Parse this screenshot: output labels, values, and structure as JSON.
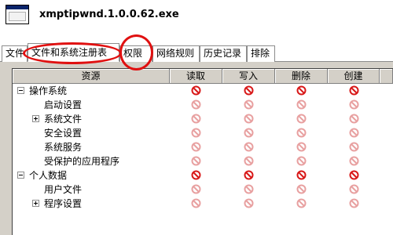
{
  "window": {
    "title": "xmptipwnd.1.0.0.62.exe"
  },
  "tabs": [
    {
      "label": "文件"
    },
    {
      "label": "文件和系统注册表"
    },
    {
      "label": "权限"
    },
    {
      "label": "网络规则"
    },
    {
      "label": "历史记录"
    },
    {
      "label": "排除"
    }
  ],
  "active_tab_index": 1,
  "table": {
    "columns": [
      "资源",
      "读取",
      "写入",
      "删除",
      "创建"
    ],
    "rows": [
      {
        "label": "操作系统",
        "level": 0,
        "expander": "minus",
        "permissions": [
          "deny",
          "deny",
          "deny",
          "deny"
        ]
      },
      {
        "label": "启动设置",
        "level": 1,
        "expander": "none",
        "permissions": [
          "deny-faded",
          "deny-faded",
          "deny-faded",
          "deny-faded"
        ]
      },
      {
        "label": "系统文件",
        "level": 1,
        "expander": "plus",
        "permissions": [
          "deny-faded",
          "deny-faded",
          "deny-faded",
          "deny-faded"
        ]
      },
      {
        "label": "安全设置",
        "level": 1,
        "expander": "none",
        "permissions": [
          "deny-faded",
          "deny-faded",
          "deny-faded",
          "deny-faded"
        ]
      },
      {
        "label": "系统服务",
        "level": 1,
        "expander": "none",
        "permissions": [
          "deny-faded",
          "deny-faded",
          "deny-faded",
          "deny-faded"
        ]
      },
      {
        "label": "受保护的应用程序",
        "level": 1,
        "expander": "none",
        "permissions": [
          "deny-faded",
          "deny-faded",
          "deny-faded",
          "deny-faded"
        ]
      },
      {
        "label": "个人数据",
        "level": 0,
        "expander": "minus",
        "permissions": [
          "deny",
          "deny",
          "deny",
          "deny"
        ]
      },
      {
        "label": "用户文件",
        "level": 1,
        "expander": "none",
        "permissions": [
          "deny-faded",
          "deny-faded",
          "deny-faded",
          "deny-faded"
        ]
      },
      {
        "label": "程序设置",
        "level": 1,
        "expander": "plus",
        "permissions": [
          "deny-faded",
          "deny-faded",
          "deny-faded",
          "deny-faded"
        ]
      }
    ]
  },
  "icons": {
    "permission": "deny-icon",
    "expand": "plus-expander-icon",
    "collapse": "minus-expander-icon"
  },
  "colors": {
    "deny": "#d81818",
    "deny_faded": "#e8a0a0",
    "annotation": "#e01010",
    "header_bg": "#d4d0c8"
  }
}
